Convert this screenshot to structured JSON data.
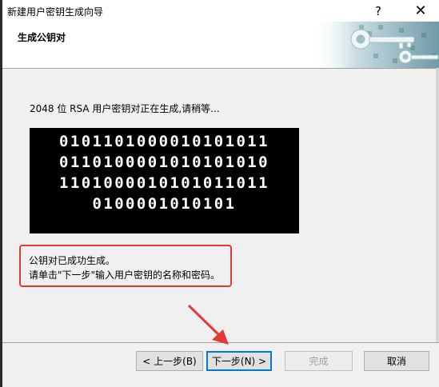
{
  "window": {
    "title": "新建用户密钥生成向导",
    "help_symbol": "?",
    "close_symbol": "✕"
  },
  "header": {
    "title": "生成公钥对"
  },
  "main": {
    "status_message": "2048 位 RSA 用户密钥对正在生成,请稍等...",
    "binary_lines": [
      "0101101000010101011",
      "0110100001010101010",
      "1101000010101011011",
      "0100001010101"
    ],
    "done_line1": "公钥对已成功生成。",
    "done_line2": "请单击\"下一步\"输入用户密钥的名称和密码。"
  },
  "buttons": {
    "back": "< 上一步(B)",
    "next": "下一步(N) >",
    "finish": "完成",
    "cancel": "取消"
  },
  "colors": {
    "highlight_frame": "#e53935",
    "arrow": "#e53935",
    "default_button_border": "#0078d7"
  }
}
